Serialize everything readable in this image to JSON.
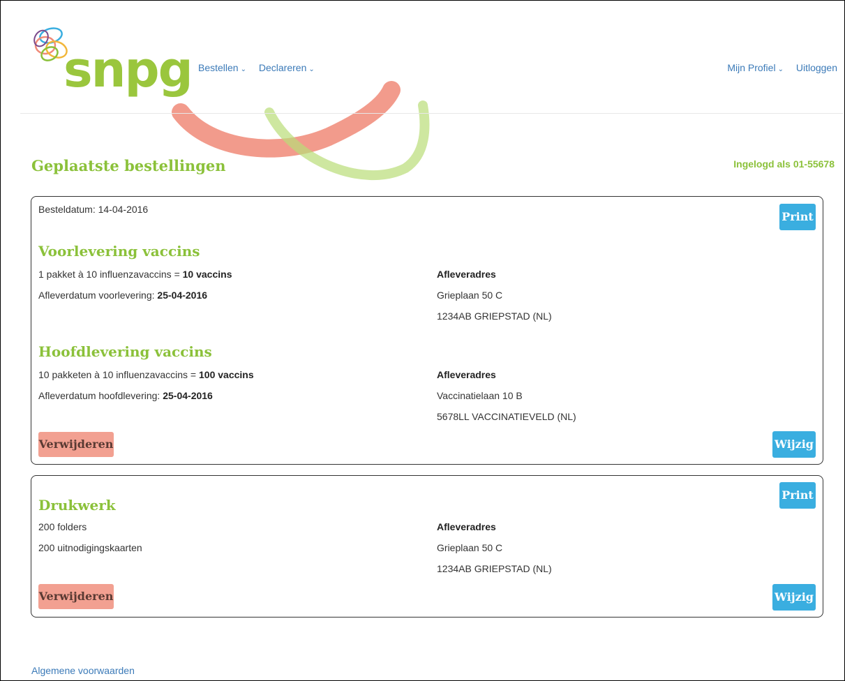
{
  "header": {
    "brand": "snpg",
    "nav_left": [
      {
        "label": "Bestellen"
      },
      {
        "label": "Declareren"
      }
    ],
    "nav_right": {
      "profile_label": "Mijn Profiel",
      "logout_label": "Uitloggen"
    }
  },
  "page": {
    "title": "Geplaatste bestellingen",
    "logged_in": "Ingelogd als 01-55678"
  },
  "orders": [
    {
      "order_date": "Besteldatum: 14-04-2016",
      "print_label": "Print",
      "delete_label": "Verwijderen",
      "edit_label": "Wijzig",
      "sections": [
        {
          "title": "Voorlevering vaccins",
          "line1_prefix": "1 pakket à 10 influenzavaccins = ",
          "line1_bold": "10 vaccins",
          "line2_prefix": "Afleverdatum voorlevering: ",
          "line2_bold": "25-04-2016",
          "address_title": "Afleveradres",
          "address_line1": "Grieplaan 50 C",
          "address_line2": "1234AB GRIEPSTAD (NL)"
        },
        {
          "title": "Hoofdlevering vaccins",
          "line1_prefix": "10 pakketen à 10 influenzavaccins = ",
          "line1_bold": "100 vaccins",
          "line2_prefix": "Afleverdatum hoofdlevering: ",
          "line2_bold": "25-04-2016",
          "address_title": "Afleveradres",
          "address_line1": "Vaccinatielaan 10 B",
          "address_line2": "5678LL VACCINATIEVELD (NL)"
        }
      ]
    },
    {
      "print_label": "Print",
      "delete_label": "Verwijderen",
      "edit_label": "Wijzig",
      "sections": [
        {
          "title": "Drukwerk",
          "line1": "200 folders",
          "line2": "200 uitnodigingskaarten",
          "address_title": "Afleveradres",
          "address_line1": "Grieplaan 50 C",
          "address_line2": "1234AB GRIEPSTAD (NL)"
        }
      ]
    }
  ],
  "footer": {
    "terms_label": "Algemene voorwaarden"
  },
  "colors": {
    "brand_green": "#8bc13a",
    "link_blue": "#3b7ab8",
    "button_blue": "#3aaee0",
    "delete_red": "#f2a091"
  },
  "icons": [
    "chevron-down-icon",
    "snpg-logo-rings"
  ]
}
